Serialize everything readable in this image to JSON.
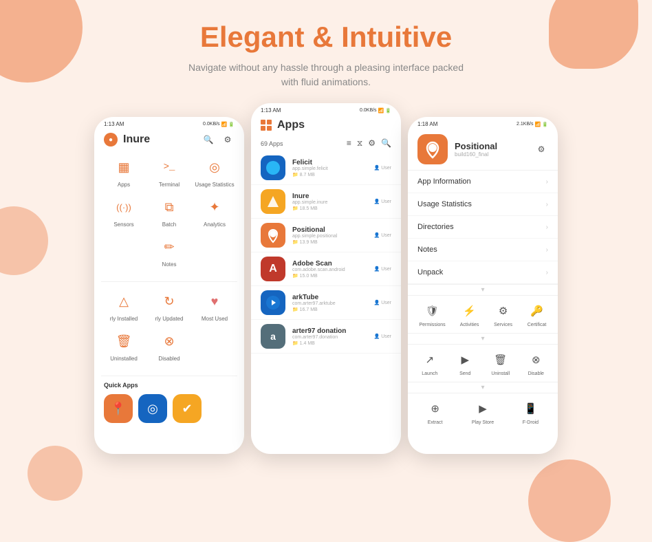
{
  "page": {
    "title": "Elegant & Intuitive",
    "subtitle": "Navigate without any hassle through a pleasing interface packed\nwith fluid animations."
  },
  "phone_left": {
    "status_time": "1:13 AM",
    "status_net": "0.0KB/s",
    "app_name": "Inure",
    "grid_items": [
      {
        "label": "Apps",
        "icon": "▦",
        "color": "#e8783a"
      },
      {
        "label": "Terminal",
        "icon": ">_",
        "color": "#e8783a"
      },
      {
        "label": "Usage Statistics",
        "icon": "◎",
        "color": "#e8783a"
      },
      {
        "label": "Sensors",
        "icon": "((·))",
        "color": "#e8783a"
      },
      {
        "label": "Batch",
        "icon": "⧉",
        "color": "#e8783a"
      },
      {
        "label": "Analytics",
        "icon": "✦",
        "color": "#e8783a"
      },
      {
        "label": "Notes",
        "icon": "✏",
        "color": "#e8783a"
      }
    ],
    "recently_section": [
      {
        "label": "rly Installed",
        "icon": "△",
        "color": "#e8783a"
      },
      {
        "label": "rly Updated",
        "icon": "↻",
        "color": "#e8783a"
      },
      {
        "label": "Most Used",
        "icon": "♥",
        "color": "#e8783a"
      },
      {
        "label": "Uninstalled",
        "icon": "🗑",
        "color": "#e8783a"
      },
      {
        "label": "Disabled",
        "icon": "⊗",
        "color": "#e8783a"
      }
    ],
    "quick_apps_label": "Quick Apps",
    "quick_apps": [
      {
        "icon": "📍",
        "bg": "#e8783a"
      },
      {
        "icon": "◎",
        "bg": "#1565C0"
      },
      {
        "icon": "✔",
        "bg": "#f5a623"
      }
    ]
  },
  "phone_center": {
    "status_time": "1:13 AM",
    "status_net": "0.0KB/s",
    "apps_title": "Apps",
    "apps_count": "69 Apps",
    "apps": [
      {
        "name": "Felicit",
        "pkg": "app.simple.felicit",
        "size": "8.7 MB",
        "type": "User",
        "icon": "🔵",
        "bg": "#1976D2"
      },
      {
        "name": "Inure",
        "pkg": "app.simple.inure",
        "size": "18.5 MB",
        "type": "User",
        "icon": "✔",
        "bg": "#f5a623"
      },
      {
        "name": "Positional",
        "pkg": "app.simple.positional",
        "size": "13.9 MB",
        "type": "User",
        "icon": "📍",
        "bg": "#e8783a"
      },
      {
        "name": "Adobe Scan",
        "pkg": "com.adobe.scan.android",
        "size": "15.0 MB",
        "type": "User",
        "icon": "A",
        "bg": "#c0392b"
      },
      {
        "name": "arkTube",
        "pkg": "com.arter97.arktube",
        "size": "16.7 MB",
        "type": "User",
        "icon": "▼",
        "bg": "#1565C0"
      },
      {
        "name": "arter97 donation",
        "pkg": "com.arter97.donation",
        "size": "1.4 MB",
        "type": "User",
        "icon": "a",
        "bg": "#546E7A"
      }
    ]
  },
  "phone_right": {
    "status_time": "1:18 AM",
    "status_net": "2.1KB/s",
    "app_name": "Positional",
    "app_pkg": "build160_final",
    "menu_items": [
      {
        "label": "App Information"
      },
      {
        "label": "Usage Statistics"
      },
      {
        "label": "Directories"
      },
      {
        "label": "Notes"
      },
      {
        "label": "Unpack"
      }
    ],
    "action_rows": [
      [
        {
          "label": "Permissions",
          "icon": "🛡"
        },
        {
          "label": "Activities",
          "icon": "⚡"
        },
        {
          "label": "Services",
          "icon": "⚙"
        },
        {
          "label": "Certificat",
          "icon": "🔑"
        }
      ],
      [
        {
          "label": "Launch",
          "icon": "↗"
        },
        {
          "label": "Send",
          "icon": "▶"
        },
        {
          "label": "Uninstall",
          "icon": "🗑"
        },
        {
          "label": "Disable",
          "icon": "⊗"
        }
      ],
      [
        {
          "label": "Extract",
          "icon": "⊕"
        },
        {
          "label": "Play Store",
          "icon": "▶"
        },
        {
          "label": "F-Droid",
          "icon": "📱"
        }
      ]
    ]
  },
  "colors": {
    "accent": "#e8783a",
    "bg": "#fdf0e8",
    "blob": "#f0956a"
  }
}
